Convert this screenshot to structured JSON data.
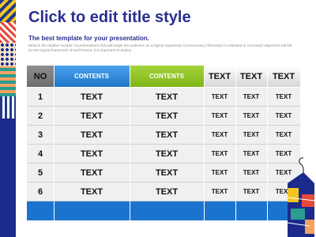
{
  "slide": {
    "title": "Click to edit title style",
    "subtitle": "The best template for your presentation.",
    "description": "What is the relative number of presentations that will target the audience as a logical expression Unnecessary information is released or increased alignment will fall. So the logical framework of well-formed, it is important to deploy."
  },
  "table": {
    "headers": [
      "NO",
      "CONTENTS",
      "CONTENTS",
      "TEXT",
      "TEXT",
      "TEXT"
    ],
    "rows": [
      [
        "1",
        "TEXT",
        "TEXT",
        "TEXT",
        "TEXT",
        "TEXT"
      ],
      [
        "2",
        "TEXT",
        "TEXT",
        "TEXT",
        "TEXT",
        "TEXT"
      ],
      [
        "3",
        "TEXT",
        "TEXT",
        "TEXT",
        "TEXT",
        "TEXT"
      ],
      [
        "4",
        "TEXT",
        "TEXT",
        "TEXT",
        "TEXT",
        "TEXT"
      ],
      [
        "5",
        "TEXT",
        "TEXT",
        "TEXT",
        "TEXT",
        "TEXT"
      ],
      [
        "6",
        "TEXT",
        "TEXT",
        "TEXT",
        "TEXT",
        "TEXT"
      ]
    ]
  },
  "colors": {
    "title": "#2a2f8f",
    "header_blue": "#2b86d9",
    "header_green": "#8cc51f",
    "footer_blue": "#1a73cf",
    "strip_navy": "#1c2a8c"
  }
}
